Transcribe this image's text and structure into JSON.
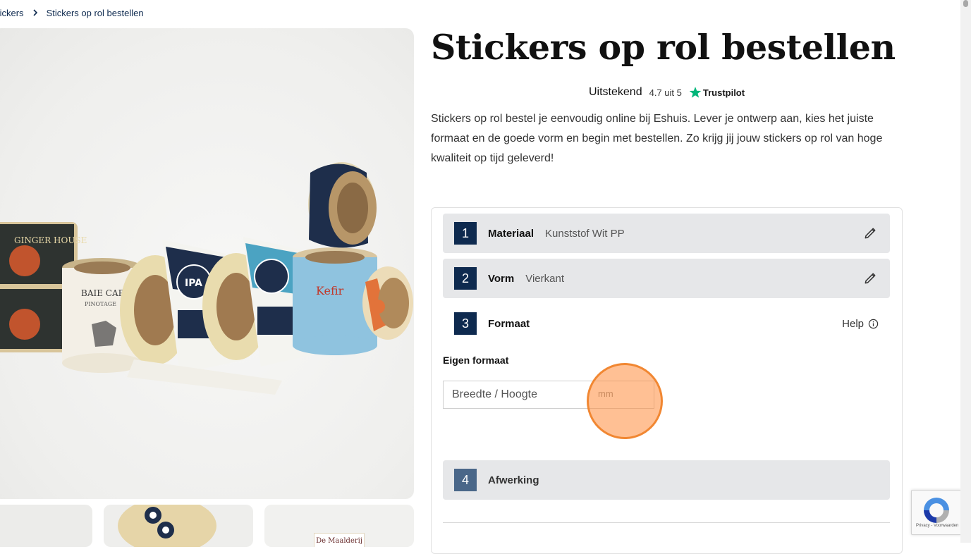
{
  "breadcrumb": {
    "previous": "tickers",
    "current": "Stickers op rol bestellen"
  },
  "page": {
    "title": "Stickers op rol bestellen"
  },
  "rating": {
    "word": "Uitstekend",
    "score": "4.7 uit 5",
    "provider": "Trustpilot"
  },
  "description": "Stickers op rol bestel je eenvoudig online bij Eshuis. Lever je ontwerp aan, kies het juiste formaat en de goede vorm en begin met bestellen. Zo krijg jij jouw stickers op rol van hoge kwaliteit op tijd geleverd!",
  "product_image": {
    "label_1": "BAIE CAP",
    "label_2": "PINOTAGE",
    "label_3": "IPA",
    "label_4": "Kefir",
    "label_5": "GINGER HOUSE",
    "thumb_label": "De Maalderij"
  },
  "steps": [
    {
      "number": "1",
      "label": "Materiaal",
      "value": "Kunststof Wit PP"
    },
    {
      "number": "2",
      "label": "Vorm",
      "value": "Vierkant"
    },
    {
      "number": "3",
      "label": "Formaat",
      "help": "Help"
    },
    {
      "number": "4",
      "label": "Afwerking"
    }
  ],
  "formaat": {
    "heading": "Eigen formaat",
    "placeholder": "Breedte / Hoogte",
    "unit": "mm"
  },
  "recaptcha": {
    "text": "Privacy - Voorwaarden"
  },
  "colors": {
    "navy": "#0e2a4f",
    "step_bg": "#e6e7e9",
    "trustpilot_green": "#00b67a",
    "click_marker": "#f5862b"
  }
}
